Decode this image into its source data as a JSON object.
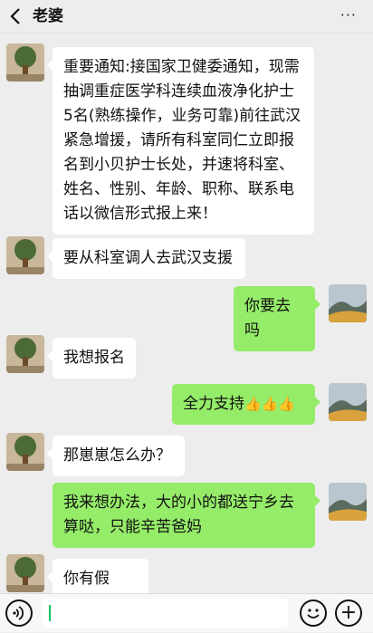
{
  "header": {
    "back_icon": "chevron-left-icon",
    "title": "老婆",
    "more_label": "···"
  },
  "messages": [
    {
      "side": "left",
      "text": "重要通知:接国家卫健委通知，现需抽调重症医学科连续血液净化护士5名(熟练操作，业务可靠)前往武汉紧急增援，请所有科室同仁立即报名到小贝护士长处，并速将科室、姓名、性别、年龄、职称、联系电话以微信形式报上来！"
    },
    {
      "side": "left",
      "text": "要从科室调人去武汉支援"
    },
    {
      "side": "right",
      "text": "你要去吗"
    },
    {
      "side": "left",
      "text": "我想报名"
    },
    {
      "side": "right",
      "text": "全力支持",
      "emoji": "👍👍👍"
    },
    {
      "side": "left",
      "text": "那崽崽怎么办？"
    },
    {
      "side": "right",
      "text": "我来想办法，大的小的都送宁乡去算哒，只能辛苦爸妈"
    },
    {
      "side": "left",
      "text": "你有假没？"
    }
  ],
  "composer": {
    "voice_icon": "voice-icon",
    "emoji_icon": "smile-icon",
    "plus_label": "+"
  },
  "colors": {
    "background": "#ededed",
    "bubble_left": "#ffffff",
    "bubble_right": "#95ec69"
  }
}
